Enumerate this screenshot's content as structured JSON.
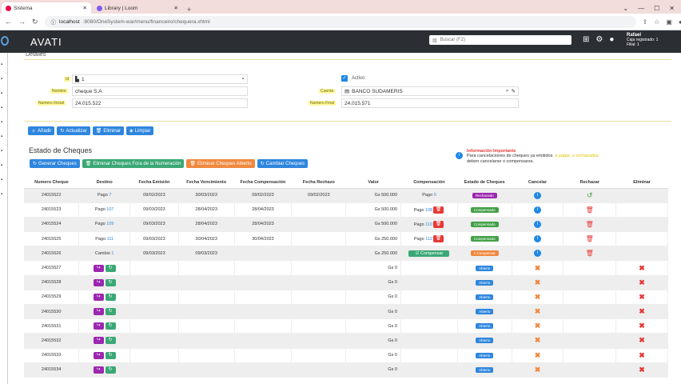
{
  "browser": {
    "tabs": [
      {
        "label": "Sistema"
      },
      {
        "label": "Library | Loom"
      }
    ],
    "url_host": "localhost",
    "url_rest": ":8080/OneSystem-war/menu/financeiro/chequera.xhtml"
  },
  "app": {
    "logo": "AVATI",
    "search_placeholder": "Buscar (F2)",
    "user_name": "Rafael",
    "user_line1": "Caja registrado: 1",
    "user_line2": "Filial: 1"
  },
  "detalles": {
    "title": "Detalles",
    "id_label": "Id",
    "id_value": "1",
    "nombre_label": "Nombre",
    "nombre_value": "cheque S.A",
    "numero_inicial_label": "Numero Inicial",
    "numero_inicial_value": "24.015.522",
    "activo_label": "Activo",
    "cuenta_label": "Cuenta",
    "cuenta_value": "BANCO SUDAMERIS",
    "numero_final_label": "Numero Final",
    "numero_final_value": "24.015.571"
  },
  "toolbar": {
    "anadir": "Añadir",
    "actualizar": "Actualizar",
    "eliminar": "Eliminar",
    "limpiar": "Limpiar"
  },
  "estado": {
    "title": "Estado de Cheques",
    "btn_generar": "Generar Cheques",
    "btn_eliminar_fuera": "Eliminar Cheques Fora de la Numeración",
    "btn_eliminar_abierto": "Eliminar Cheques Abierto",
    "btn_cambiar": "Cambiar Cheques"
  },
  "info": {
    "title": "Información Importante",
    "text": "Para cancelaciones de cheques ya emitidos",
    "text_mid": ", a pagar, o rechazados,",
    "text2": "deben cancelarse o compensarse."
  },
  "table": {
    "headers": [
      "Numero Cheque",
      "Destino",
      "Fecha Emisión",
      "Fecha Vencimiento",
      "Fecha Compensación",
      "Fecha Rechazo",
      "Valor",
      "Compensación",
      "Estado de Cheques",
      "Cancelar",
      "Rechazar",
      "Eliminar"
    ],
    "rows": [
      {
        "num": "24015522",
        "destino": "Pago",
        "ref": "7",
        "emision": "09/02/2023",
        "venc": "30/03/2023",
        "comp": "09/02/2023",
        "rech": "09/02/2023",
        "valor": "Gs 500.000",
        "comp_pago": "Pago",
        "comp_ref": "0",
        "estado": "Rechazado"
      },
      {
        "num": "24015523",
        "destino": "Pago",
        "ref": "107",
        "emision": "09/03/2023",
        "venc": "28/04/2023",
        "comp": "28/04/2023",
        "rech": "",
        "valor": "Gs 500.000",
        "comp_pago": "Pago",
        "comp_ref": "108",
        "estado": "Compensado"
      },
      {
        "num": "24015524",
        "destino": "Pago",
        "ref": "109",
        "emision": "09/03/2023",
        "venc": "28/04/2023",
        "comp": "28/04/2023",
        "rech": "",
        "valor": "Gs 500.000",
        "comp_pago": "Pago",
        "comp_ref": "110",
        "estado": "Compensado"
      },
      {
        "num": "24015525",
        "destino": "Pago",
        "ref": "111",
        "emision": "09/03/2023",
        "venc": "30/04/2023",
        "comp": "30/04/2023",
        "rech": "",
        "valor": "Gs 250.000",
        "comp_pago": "Pago",
        "comp_ref": "112",
        "estado": "Compensado"
      },
      {
        "num": "24015526",
        "destino": "Cambio",
        "ref": "1",
        "emision": "09/03/2023",
        "venc": "09/03/2023",
        "comp": "",
        "rech": "",
        "valor": "Gs 250.000",
        "compensar": "Compensar",
        "estado": "A Compensar"
      },
      {
        "num": "24015527",
        "valor": "Gs 0",
        "estado": "Abierto"
      },
      {
        "num": "24015528",
        "valor": "Gs 0",
        "estado": "Abierto"
      },
      {
        "num": "24015529",
        "valor": "Gs 0",
        "estado": "Abierto"
      },
      {
        "num": "24015530",
        "valor": "Gs 0",
        "estado": "Abierto"
      },
      {
        "num": "24015531",
        "valor": "Gs 0",
        "estado": "Abierto"
      },
      {
        "num": "24015532",
        "valor": "Gs 0",
        "estado": "Abierto"
      },
      {
        "num": "24015533",
        "valor": "Gs 0",
        "estado": "Abierto"
      },
      {
        "num": "24015534",
        "valor": "Gs 0",
        "estado": "Abierto"
      }
    ]
  }
}
